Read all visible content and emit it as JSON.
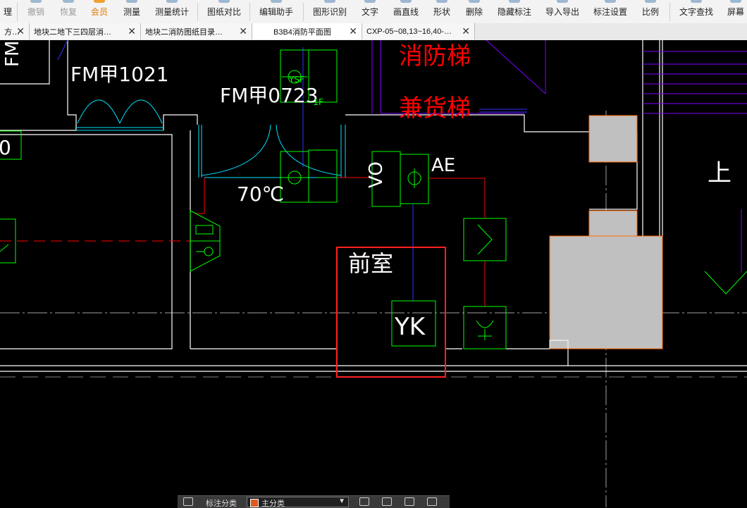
{
  "toolbar": {
    "items": [
      {
        "label": "理",
        "state": "normal"
      },
      {
        "label": "撤销",
        "state": "disabled"
      },
      {
        "label": "恢复",
        "state": "disabled"
      },
      {
        "label": "会员",
        "state": "highlight"
      },
      {
        "label": "测量",
        "state": "normal"
      },
      {
        "label": "测量统计",
        "state": "normal"
      },
      {
        "label": "图纸对比",
        "state": "normal"
      },
      {
        "label": "编辑助手",
        "state": "normal"
      },
      {
        "label": "图形识别",
        "state": "normal"
      },
      {
        "label": "文字",
        "state": "normal"
      },
      {
        "label": "画直线",
        "state": "normal"
      },
      {
        "label": "形状",
        "state": "normal"
      },
      {
        "label": "删除",
        "state": "normal"
      },
      {
        "label": "隐藏标注",
        "state": "normal"
      },
      {
        "label": "导入导出",
        "state": "normal"
      },
      {
        "label": "标注设置",
        "state": "normal"
      },
      {
        "label": "比例",
        "state": "normal"
      },
      {
        "label": "文字查找",
        "state": "normal"
      },
      {
        "label": "屏幕",
        "state": "normal"
      }
    ]
  },
  "tabs": [
    {
      "label": "方…",
      "close": "✕"
    },
    {
      "label": "地块二地下三四层消…",
      "close": "✕"
    },
    {
      "label": "地块二消防图纸目录…",
      "close": "✕"
    },
    {
      "label": "B3B4消防平面图",
      "close": "✕"
    },
    {
      "label": "CXP-05~08,13~16,40-…",
      "close": "✕"
    }
  ],
  "drawing": {
    "texts": {
      "fm_top": "FM",
      "fm1021": "FM甲1021",
      "fm0723": "FM甲0723",
      "ysf": "YSF",
      "floor": "-1F",
      "fire_elevator": "消防梯",
      "freight_elevator": "兼货梯",
      "temp": "70℃",
      "ae": "AE",
      "room": "前室",
      "yk": "YK",
      "shang": "上",
      "left_zero": "0"
    },
    "colors": {
      "wall": "#ffffff",
      "equipment": "#00ff00",
      "annotation_red": "#ff0000",
      "door": "#00e5ff",
      "stair_purple": "#8000ff",
      "column_fill": "#c0c0c0",
      "column_stroke": "#ff6a00",
      "highlight_box": "#ff2020",
      "axis_grey": "#a0a0a0",
      "blue_line": "#3030ff"
    }
  },
  "bottom_panel": {
    "label": "标注分类",
    "selected_option": "主分类",
    "caret": "▼"
  }
}
